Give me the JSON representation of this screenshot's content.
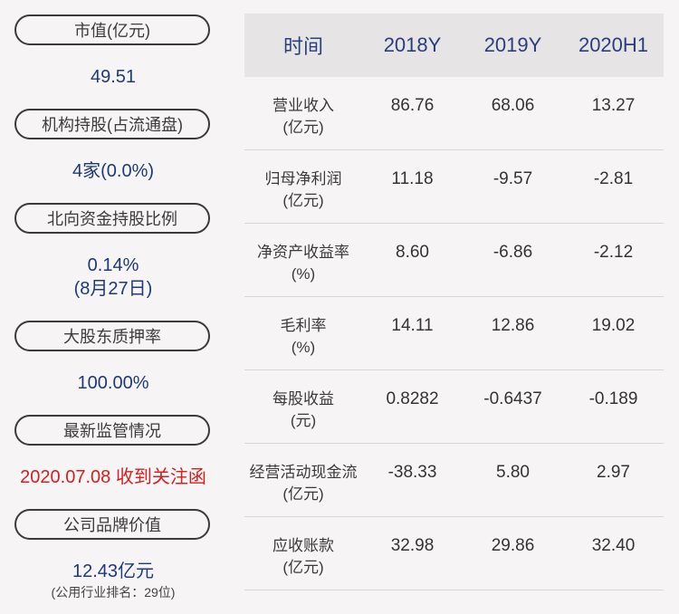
{
  "left": {
    "items": [
      {
        "label": "市值(亿元)",
        "value": "49.51"
      },
      {
        "label": "机构持股(占流通盘)",
        "value": "4家(0.0%)"
      },
      {
        "label": "北向资金持股比例",
        "value": "0.14%",
        "value2": "(8月27日)"
      },
      {
        "label": "大股东质押率",
        "value": "100.00%"
      },
      {
        "label": "最新监管情况",
        "value": "2020.07.08 收到关注函"
      },
      {
        "label": "公司品牌价值",
        "value": "12.43亿元",
        "note": "(公用行业排名：29位)"
      }
    ]
  },
  "table": {
    "headers": [
      "时间",
      "2018Y",
      "2019Y",
      "2020H1"
    ],
    "rows": [
      {
        "name1": "营业收入",
        "name2": "(亿元)",
        "v": [
          "86.76",
          "68.06",
          "13.27"
        ]
      },
      {
        "name1": "归母净利润",
        "name2": "(亿元)",
        "v": [
          "11.18",
          "-9.57",
          "-2.81"
        ]
      },
      {
        "name1": "净资产收益率",
        "name2": "(%)",
        "v": [
          "8.60",
          "-6.86",
          "-2.12"
        ]
      },
      {
        "name1": "毛利率",
        "name2": "(%)",
        "v": [
          "14.11",
          "12.86",
          "19.02"
        ]
      },
      {
        "name1": "每股收益",
        "name2": "(元)",
        "v": [
          "0.8282",
          "-0.6437",
          "-0.189"
        ]
      },
      {
        "name1": "经营活动现金流",
        "name2": "(亿元)",
        "v": [
          "-38.33",
          "5.80",
          "2.97"
        ]
      },
      {
        "name1": "应收账款",
        "name2": "(亿元)",
        "v": [
          "32.98",
          "29.86",
          "32.40"
        ]
      }
    ]
  }
}
